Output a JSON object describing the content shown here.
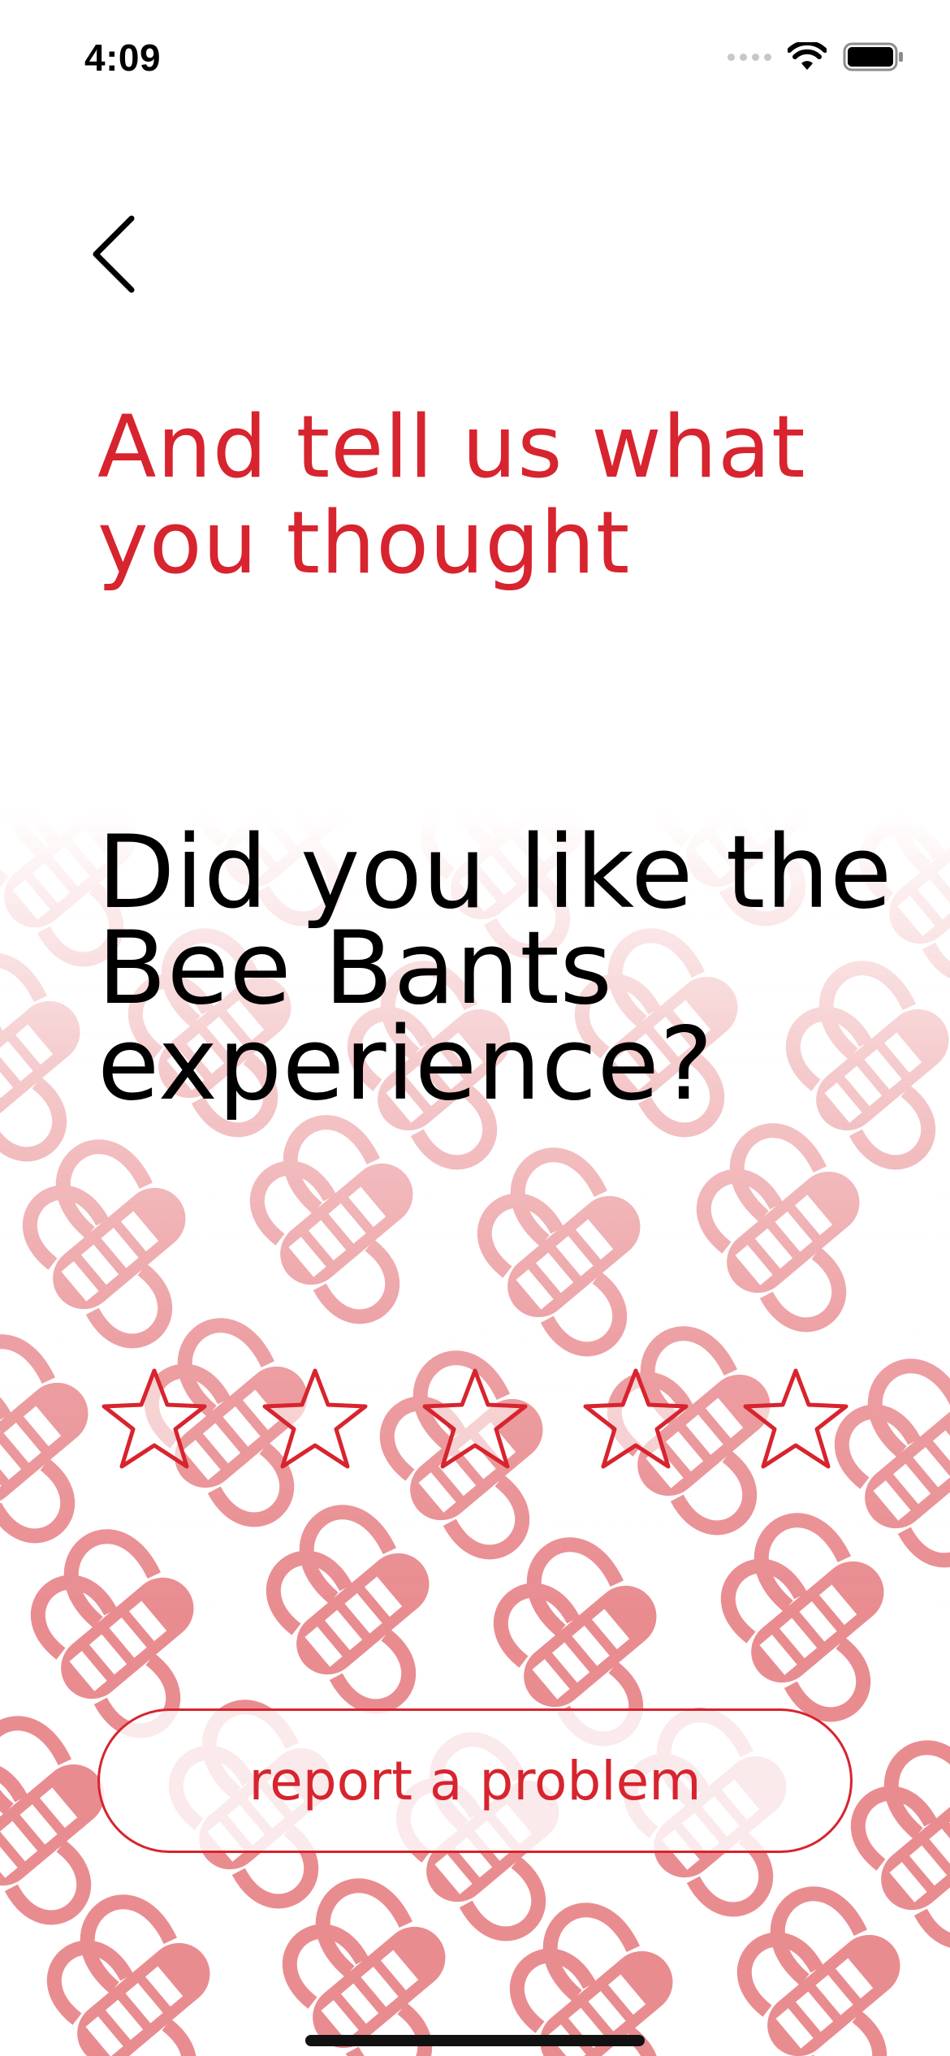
{
  "status_bar": {
    "time": "4:09"
  },
  "heading": {
    "text": "And tell us what you thought"
  },
  "question": {
    "text": "Did you like the Bee Bants experience?"
  },
  "rating": {
    "max_stars": 5,
    "selected": 0
  },
  "report_button": {
    "label": "report a problem"
  },
  "colors": {
    "accent": "#d7242e",
    "pattern": "#e8868b",
    "text": "#000000",
    "background": "#ffffff"
  },
  "icons": {
    "back": "chevron-left-icon",
    "star": "star-outline-icon",
    "wifi": "wifi-icon",
    "battery": "battery-icon",
    "signal": "cellular-signal-icon"
  }
}
